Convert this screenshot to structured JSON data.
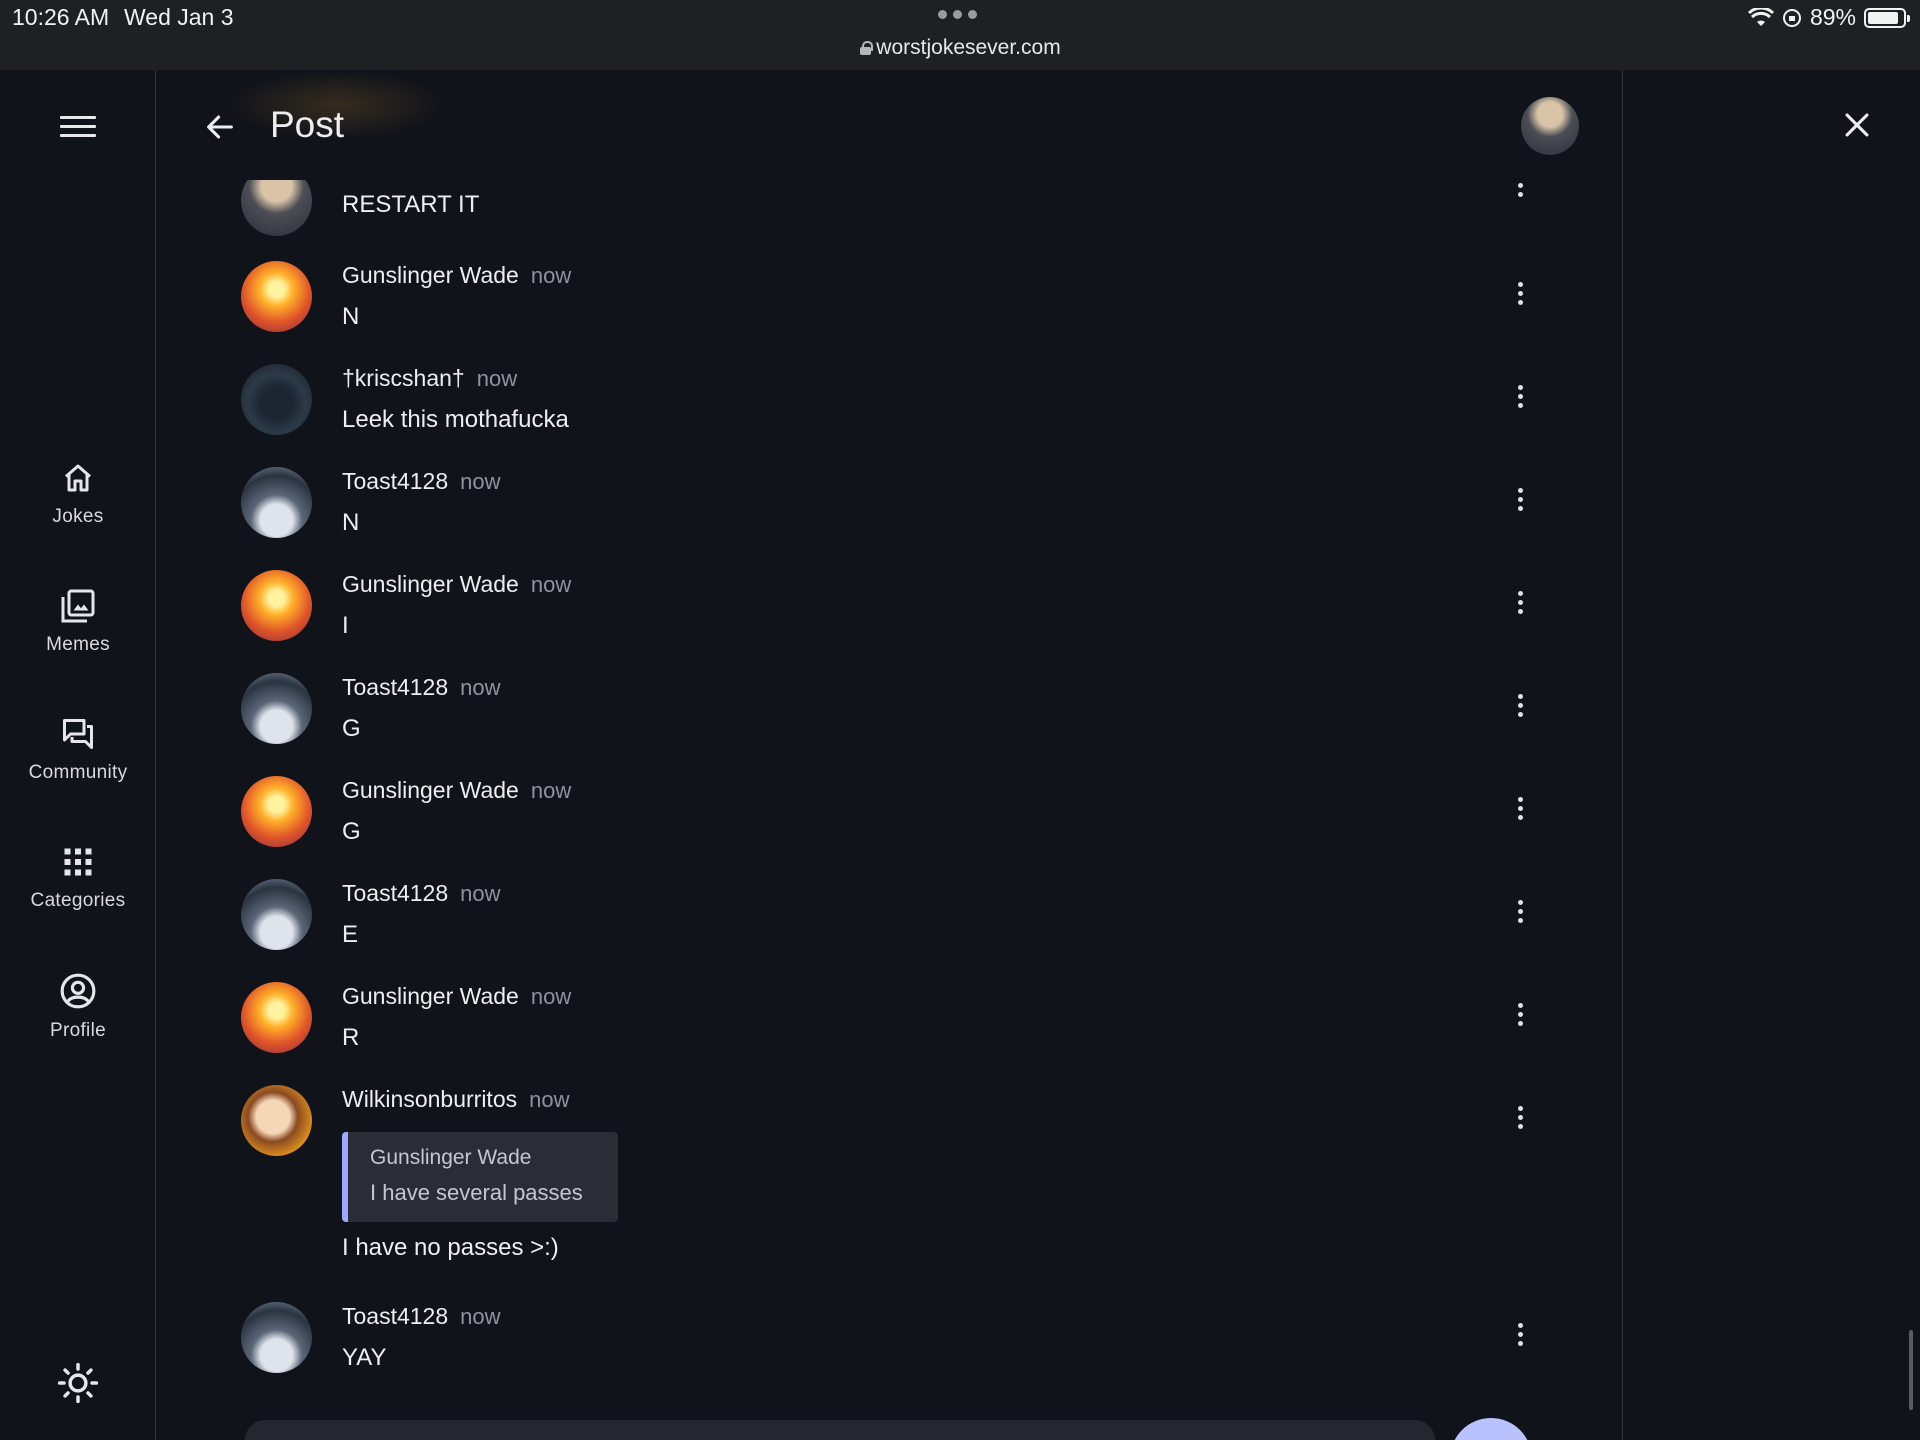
{
  "status_bar": {
    "time": "10:26 AM",
    "date": "Wed Jan 3",
    "url": "worstjokesever.com",
    "battery": "89%",
    "battery_level": 0.89
  },
  "nav": {
    "items": [
      {
        "label": "Jokes",
        "icon": "home-icon"
      },
      {
        "label": "Memes",
        "icon": "image-gallery-icon"
      },
      {
        "label": "Community",
        "icon": "chat-bubbles-icon"
      },
      {
        "label": "Categories",
        "icon": "grid-icon"
      },
      {
        "label": "Profile",
        "icon": "account-circle-icon"
      }
    ],
    "theme_icon": "sun-icon"
  },
  "header": {
    "title": "Post"
  },
  "comments": [
    {
      "author": "",
      "time": "",
      "text": "RESTART IT",
      "avatar": "top"
    },
    {
      "author": "Gunslinger Wade",
      "time": "now",
      "text": "N",
      "avatar": "gun"
    },
    {
      "author": "†kriscshan†",
      "time": "now",
      "text": "Leek this mothafucka",
      "avatar": "kris"
    },
    {
      "author": "Toast4128",
      "time": "now",
      "text": "N",
      "avatar": "toast"
    },
    {
      "author": "Gunslinger Wade",
      "time": "now",
      "text": "I",
      "avatar": "gun"
    },
    {
      "author": "Toast4128",
      "time": "now",
      "text": "G",
      "avatar": "toast"
    },
    {
      "author": "Gunslinger Wade",
      "time": "now",
      "text": "G",
      "avatar": "gun"
    },
    {
      "author": "Toast4128",
      "time": "now",
      "text": "E",
      "avatar": "toast"
    },
    {
      "author": "Gunslinger Wade",
      "time": "now",
      "text": "R",
      "avatar": "gun"
    },
    {
      "author": "Wilkinsonburritos",
      "time": "now",
      "text": "I have no passes >:)",
      "avatar": "wilk",
      "quote": {
        "author": "Gunslinger Wade",
        "text": "I have several passes"
      }
    },
    {
      "author": "Toast4128",
      "time": "now",
      "text": "YAY",
      "avatar": "toast"
    }
  ],
  "colors": {
    "background": "#11131a",
    "accent": "#9fa8ff",
    "fab": "#b9c1ff"
  }
}
